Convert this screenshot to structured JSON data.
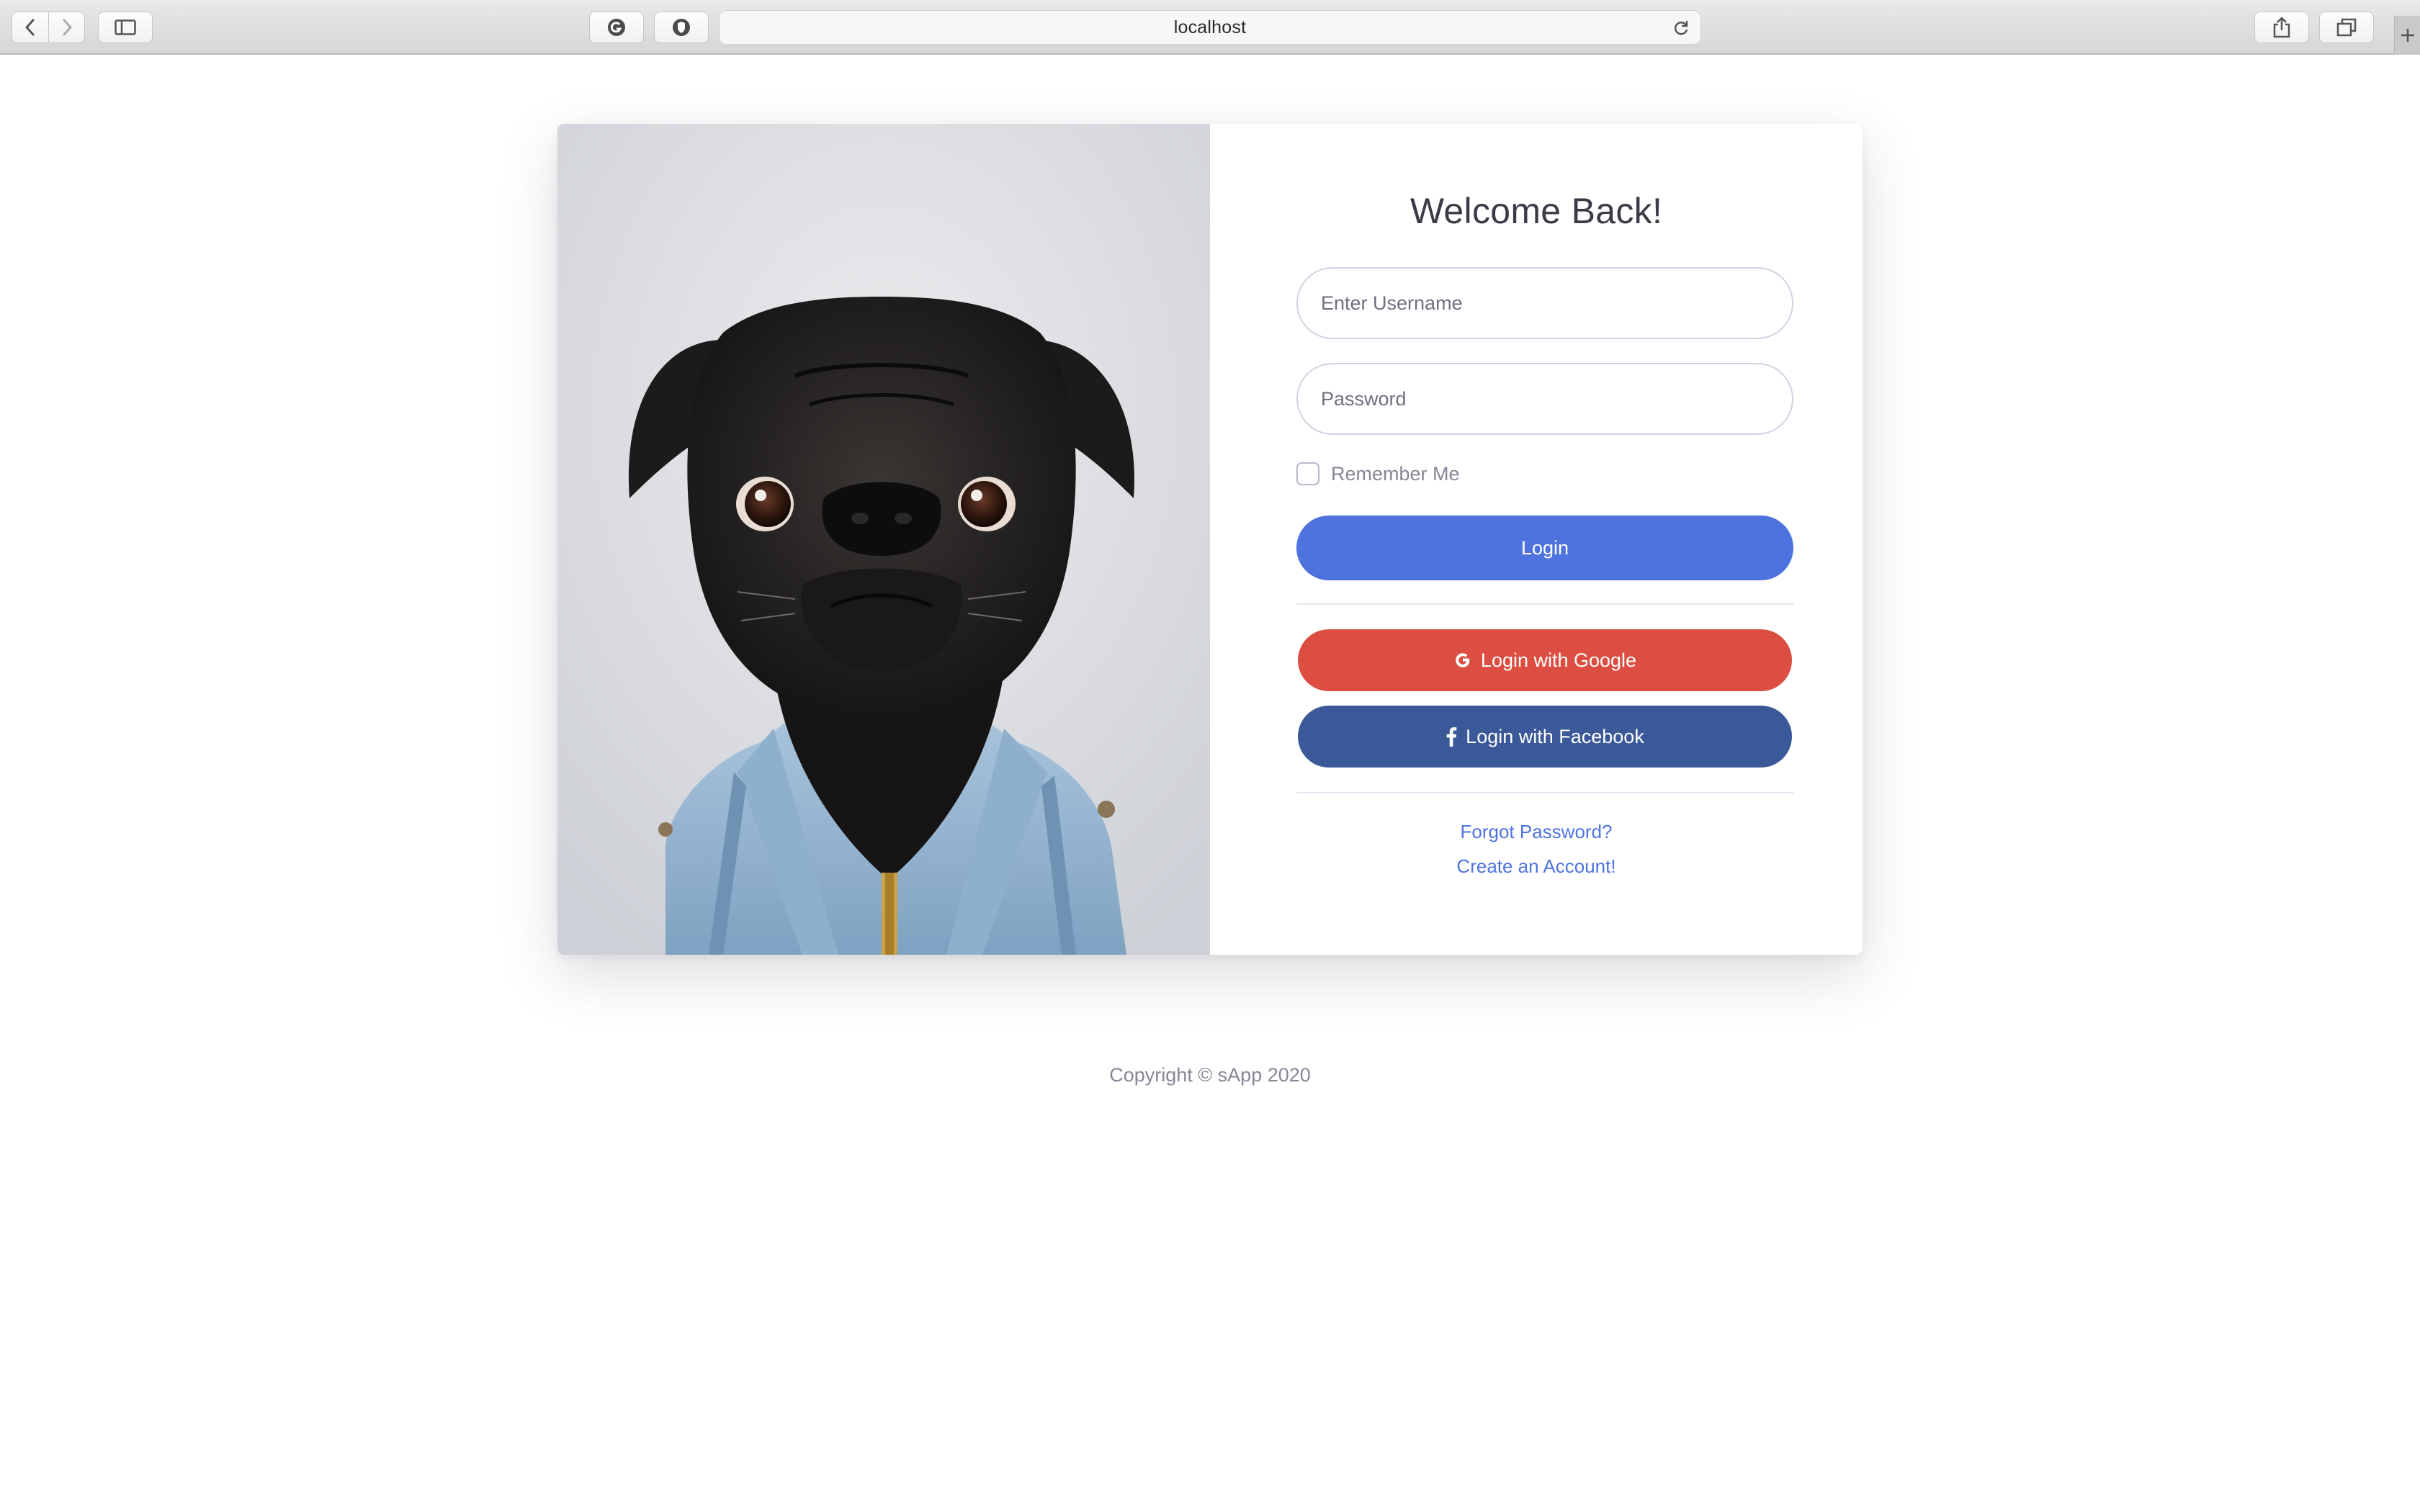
{
  "browser": {
    "url": "localhost"
  },
  "login": {
    "title": "Welcome Back!",
    "username_placeholder": "Enter Username",
    "password_placeholder": "Password",
    "remember_label": "Remember Me",
    "remember_checked": false,
    "login_label": "Login",
    "google_label": "Login with Google",
    "facebook_label": "Login with Facebook",
    "forgot_link": "Forgot Password?",
    "create_link": "Create an Account!"
  },
  "icons": {
    "google": "google-g-icon",
    "facebook": "facebook-f-icon"
  },
  "colors": {
    "primary": "#4e73df",
    "google": "#dc4e41",
    "facebook": "#3b5998",
    "text": "#3a3b45",
    "muted": "#858796"
  },
  "footer": {
    "copyright": "Copyright © sApp 2020"
  }
}
